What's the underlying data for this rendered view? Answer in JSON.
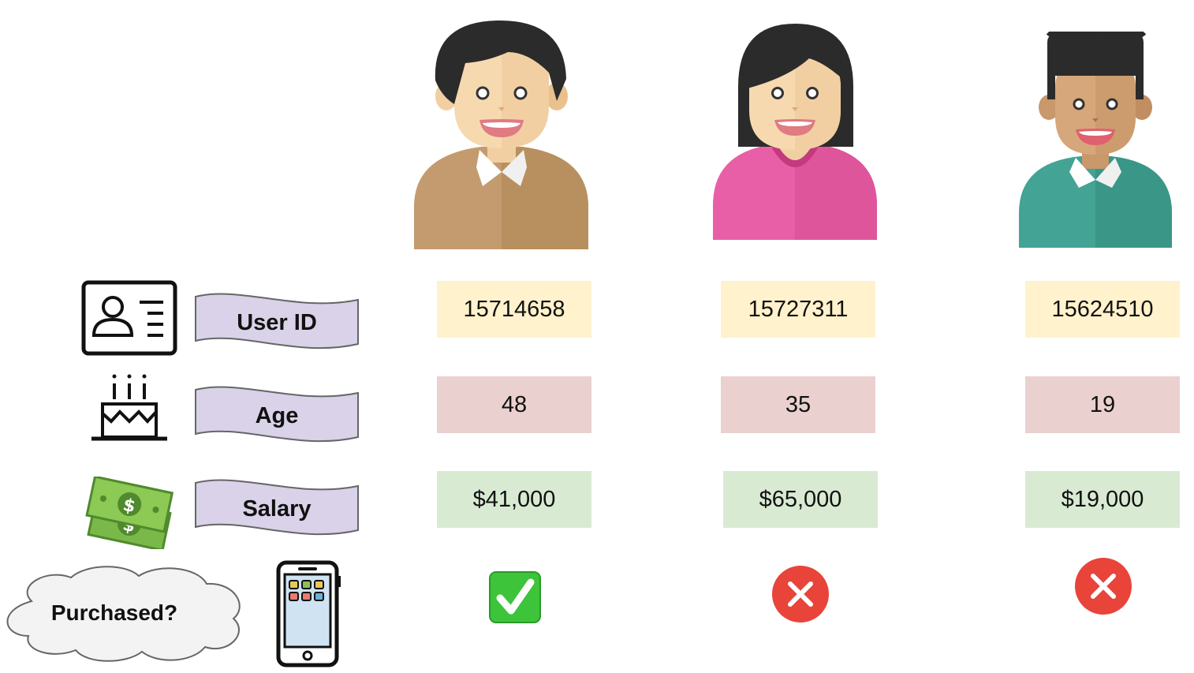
{
  "labels": {
    "user_id": "User ID",
    "age": "Age",
    "salary": "Salary",
    "purchased": "Purchased?"
  },
  "users": [
    {
      "user_id": "15714658",
      "age": "48",
      "salary": "$41,000",
      "purchased": true,
      "shirt_color": "#c39b6e"
    },
    {
      "user_id": "15727311",
      "age": "35",
      "salary": "$65,000",
      "purchased": false,
      "shirt_color": "#e95fa7"
    },
    {
      "user_id": "15624510",
      "age": "19",
      "salary": "$19,000",
      "purchased": false,
      "shirt_color": "#43a394"
    }
  ],
  "colors": {
    "user_id_cell": "#fff2cc",
    "age_cell": "#ead1d0",
    "salary_cell": "#d9ead3",
    "banner_fill": "#d9d2e9",
    "check_green": "#3ec43a",
    "cross_red": "#e8443a"
  },
  "icons": [
    "id-card-icon",
    "birthday-cake-icon",
    "money-icon",
    "cloud-icon",
    "smartphone-icon",
    "check-icon",
    "cross-icon"
  ]
}
